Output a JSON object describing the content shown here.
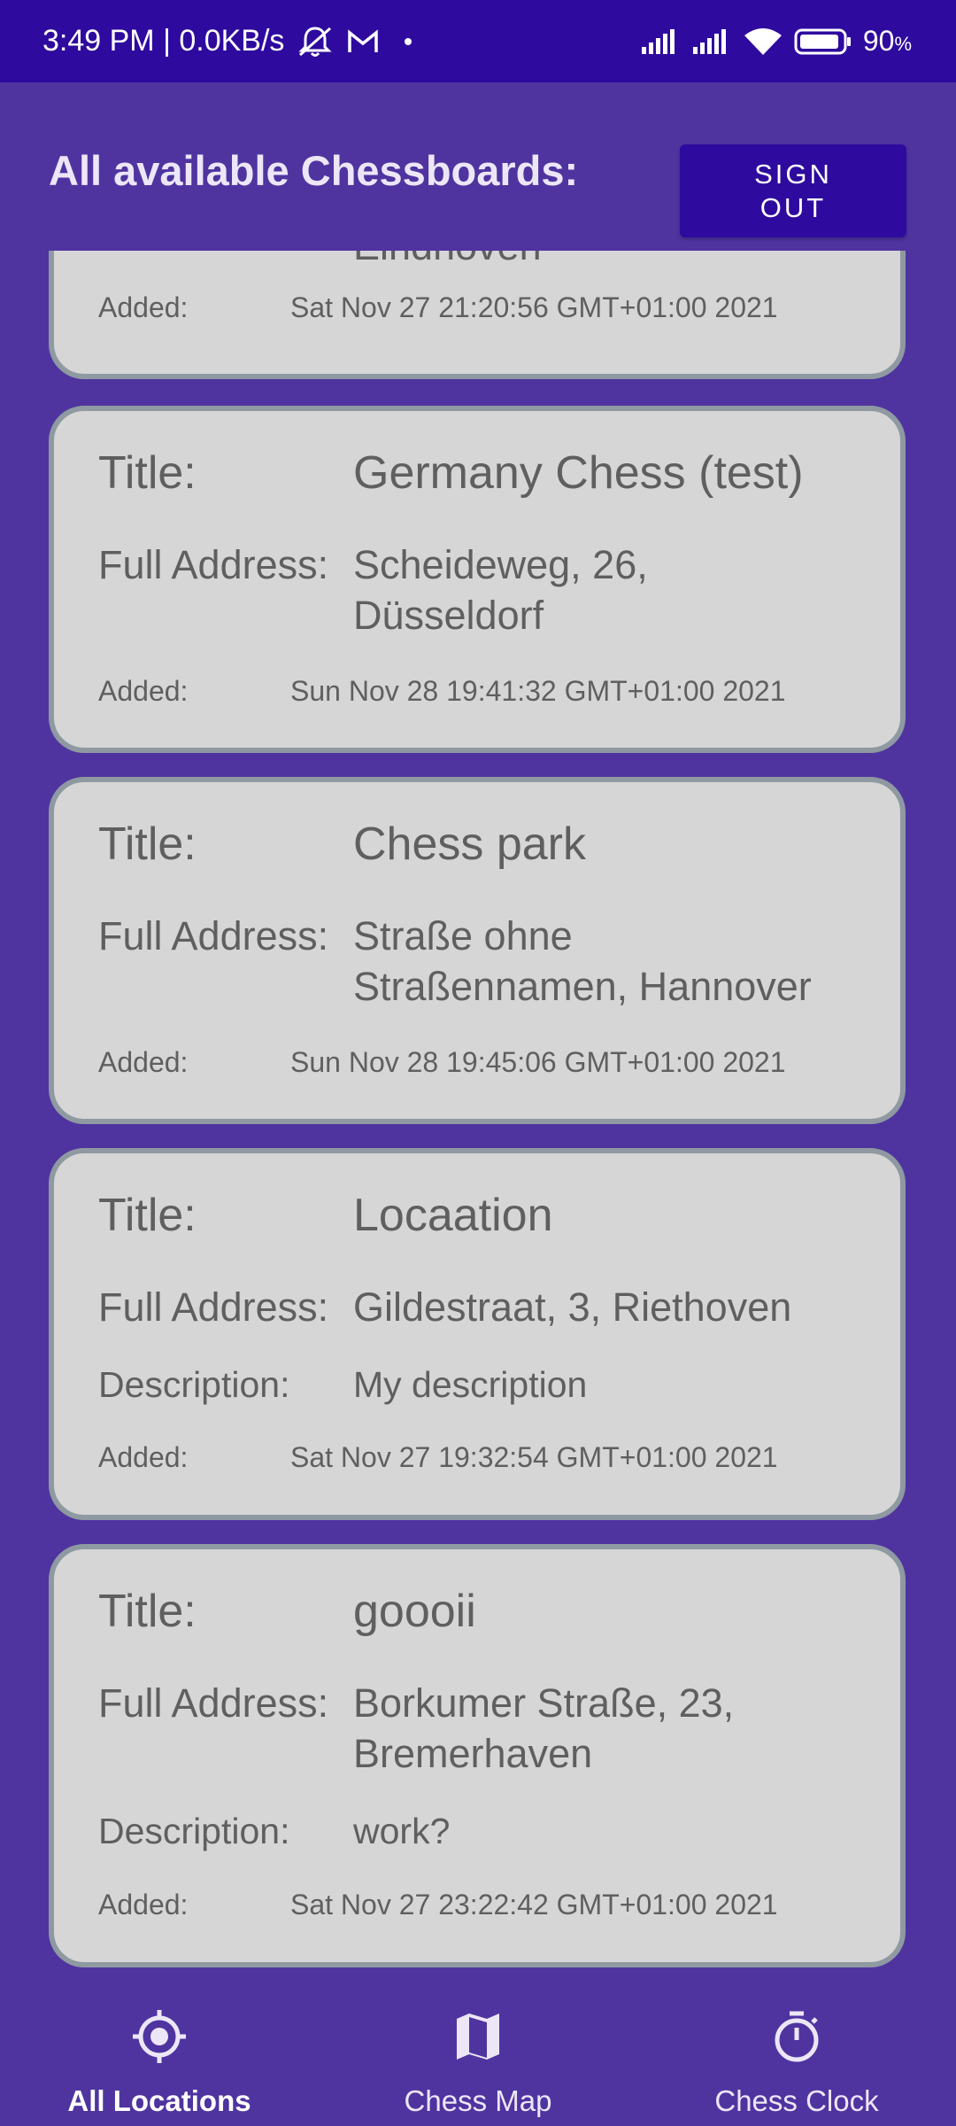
{
  "status_bar": {
    "time_speed": "3:49 PM | 0.0KB/s",
    "battery_level": "90",
    "battery_unit": "%",
    "icons": [
      "mute-icon",
      "gmail-icon",
      "dot-icon",
      "signal-icon",
      "signal-icon",
      "wifi-icon",
      "battery-icon"
    ]
  },
  "header": {
    "title": "All available Chessboards:",
    "signout_line1": "SIGN",
    "signout_line2": "OUT"
  },
  "labels": {
    "title": "Title:",
    "address": "Full Address:",
    "description": "Description:",
    "added": "Added:"
  },
  "cards": [
    {
      "address_partial": "Eindhoven",
      "added": "Sat Nov 27 21:20:56 GMT+01:00 2021"
    },
    {
      "title": "Germany Chess (test)",
      "address_line1": "Scheideweg, 26,",
      "address_line2": "Düsseldorf",
      "added": "Sun Nov 28 19:41:32 GMT+01:00 2021"
    },
    {
      "title": "Chess park",
      "address_line1": "Straße ohne",
      "address_line2": "Straßennamen, Hannover",
      "added": "Sun Nov 28 19:45:06 GMT+01:00 2021"
    },
    {
      "title": "Locaation",
      "address_line1": "Gildestraat, 3, Riethoven",
      "description": "My description",
      "added": "Sat Nov 27 19:32:54 GMT+01:00 2021"
    },
    {
      "title": "goooii",
      "address_line1": "Borkumer Straße, 23,",
      "address_line2": "Bremerhaven",
      "description": "work?",
      "added": "Sat Nov 27 23:22:42 GMT+01:00 2021"
    }
  ],
  "nav": {
    "items": [
      {
        "label": "All Locations",
        "icon": "location-target-icon",
        "active": true
      },
      {
        "label": "Chess Map",
        "icon": "map-icon",
        "active": false
      },
      {
        "label": "Chess Clock",
        "icon": "stopwatch-icon",
        "active": false
      }
    ]
  },
  "colors": {
    "status_bar": "#2e0a9e",
    "background": "#4f34a0",
    "card": "#d6d6d6",
    "card_border": "#8f99a1",
    "button": "#2e0a9e"
  }
}
